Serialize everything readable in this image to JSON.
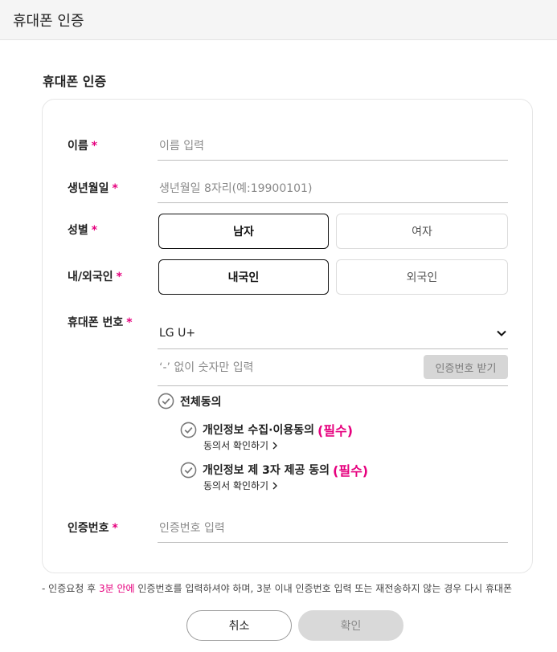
{
  "header": {
    "title": "휴대폰 인증"
  },
  "section_title": "휴대폰 인증",
  "required_mark": "*",
  "form": {
    "name": {
      "label": "이름",
      "placeholder": "이름 입력"
    },
    "birth": {
      "label": "생년월일",
      "placeholder": "생년월일 8자리(예:19900101)"
    },
    "gender": {
      "label": "성별",
      "options": [
        "남자",
        "여자"
      ],
      "selected": "남자"
    },
    "nationality": {
      "label": "내/외국인",
      "options": [
        "내국인",
        "외국인"
      ],
      "selected": "내국인"
    },
    "phone": {
      "label": "휴대폰 번호",
      "carrier": "LG U+",
      "placeholder": "‘-’ 없이 숫자만 입력",
      "request_button": "인증번호 받기"
    },
    "agreements": {
      "all_label": "전체동의",
      "items": [
        {
          "label": "개인정보 수집·이용동의",
          "required": "(필수)",
          "link": "동의서 확인하기"
        },
        {
          "label": "개인정보 제 3자 제공 동의",
          "required": "(필수)",
          "link": "동의서 확인하기"
        }
      ]
    },
    "code": {
      "label": "인증번호",
      "placeholder": "인증번호 입력"
    }
  },
  "notice": {
    "bullet": "-",
    "pre": " 인증요청 후 ",
    "highlight": "3분 안에",
    "post": " 인증번호를 입력하셔야 하며, 3분 이내 인증번호 입력 또는 재전송하지 않는 경우 다시 휴대폰"
  },
  "buttons": {
    "cancel": "취소",
    "confirm": "확인"
  },
  "colors": {
    "accent": "#e6007e",
    "disabled": "#d9d9d9",
    "border": "#bdbdbd"
  }
}
